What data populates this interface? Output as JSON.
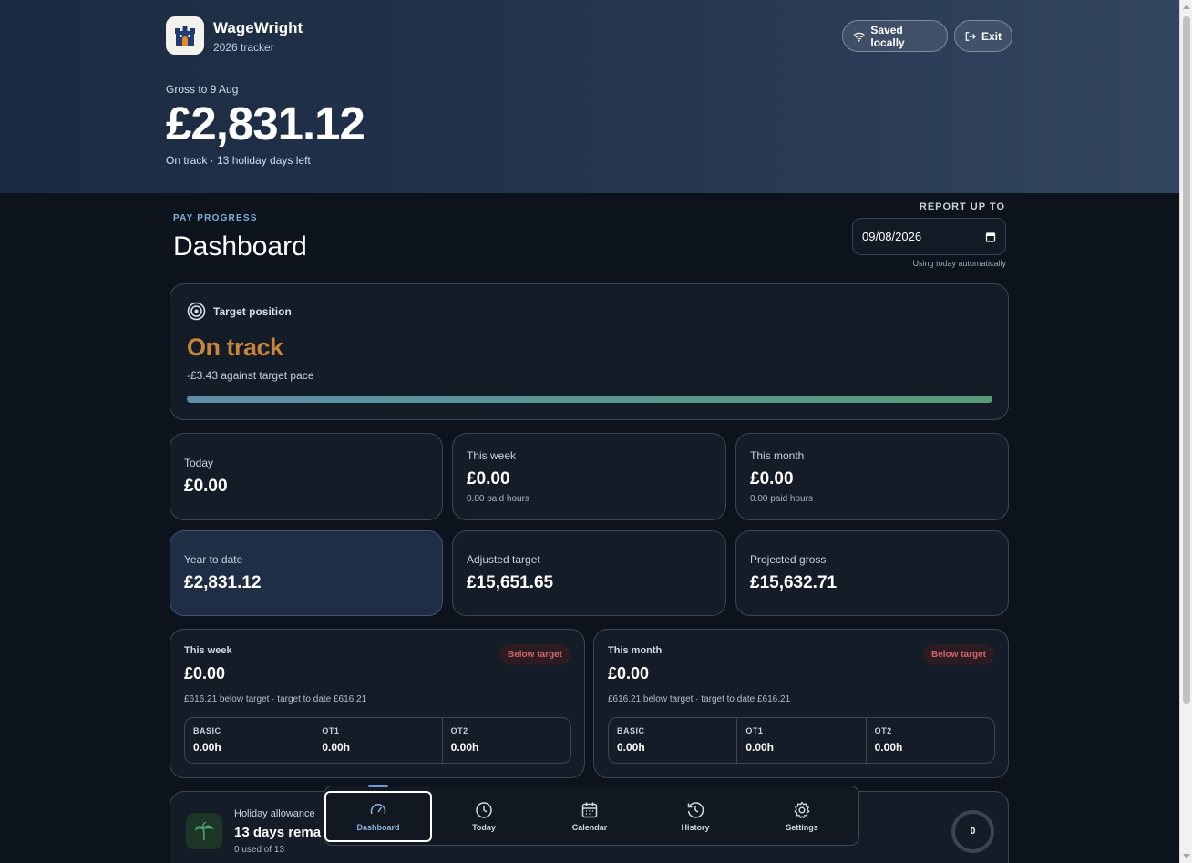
{
  "app": {
    "name": "WageWright",
    "subtitle": "2026 tracker",
    "saved_label": "Saved locally",
    "exit_label": "Exit"
  },
  "hero": {
    "gross_label": "Gross to 9 Aug",
    "gross_value": "£2,831.12",
    "status": "On track · 13 holiday days left"
  },
  "page": {
    "eyebrow": "PAY PROGRESS",
    "title": "Dashboard",
    "report_label": "REPORT UP TO",
    "report_date": "09/08/2026",
    "report_hint": "Using today automatically"
  },
  "target": {
    "heading": "Target position",
    "status": "On track",
    "delta": "-£3.43 against target pace",
    "progress_fraction": 1.0
  },
  "stats": [
    {
      "label": "Today",
      "value": "£0.00",
      "sub": ""
    },
    {
      "label": "This week",
      "value": "£0.00",
      "sub": "0.00 paid hours"
    },
    {
      "label": "This month",
      "value": "£0.00",
      "sub": "0.00 paid hours"
    },
    {
      "label": "Year to date",
      "value": "£2,831.12",
      "sub": ""
    },
    {
      "label": "Adjusted target",
      "value": "£15,651.65",
      "sub": ""
    },
    {
      "label": "Projected gross",
      "value": "£15,632.71",
      "sub": ""
    }
  ],
  "panels": [
    {
      "label": "This week",
      "value": "£0.00",
      "badge": "Below target",
      "note": "£616.21 below target · target to date £616.21",
      "hours": [
        {
          "label": "BASIC",
          "value": "0.00h"
        },
        {
          "label": "OT1",
          "value": "0.00h"
        },
        {
          "label": "OT2",
          "value": "0.00h"
        }
      ]
    },
    {
      "label": "This month",
      "value": "£0.00",
      "badge": "Below target",
      "note": "£616.21 below target · target to date £616.21",
      "hours": [
        {
          "label": "BASIC",
          "value": "0.00h"
        },
        {
          "label": "OT1",
          "value": "0.00h"
        },
        {
          "label": "OT2",
          "value": "0.00h"
        }
      ]
    }
  ],
  "holiday": {
    "label": "Holiday allowance",
    "value": "13 days rema",
    "sub": "0 used of 13",
    "ring_value": "0"
  },
  "nav": [
    {
      "label": "Dashboard",
      "icon": "gauge-icon",
      "active": true
    },
    {
      "label": "Today",
      "icon": "clock-icon",
      "active": false
    },
    {
      "label": "Calendar",
      "icon": "calendar-icon",
      "active": false
    },
    {
      "label": "History",
      "icon": "history-icon",
      "active": false
    },
    {
      "label": "Settings",
      "icon": "gear-icon",
      "active": false
    }
  ],
  "colors": {
    "accent_orange": "#c9853a",
    "below_target": "#d0646a",
    "eyebrow_blue": "#7fb0d9"
  }
}
